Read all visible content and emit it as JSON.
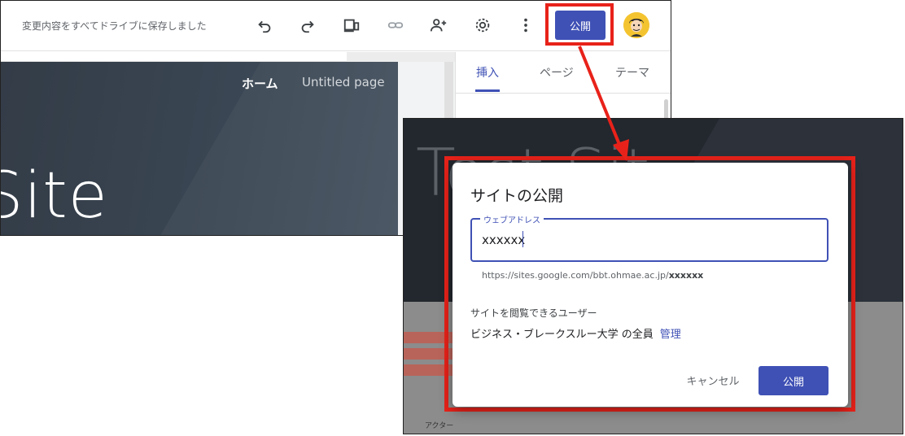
{
  "editor": {
    "save_status": "変更内容をすべてドライブに保存しました",
    "toolbar_icons": [
      "undo-icon",
      "redo-icon",
      "preview-devices-icon",
      "link-icon",
      "share-person-add-icon",
      "settings-gear-icon",
      "more-vert-icon"
    ],
    "publish_label": "公開",
    "nav": {
      "home": "ホーム",
      "untitled": "Untitled page"
    },
    "site_title_fragment": "Site",
    "side_tabs": {
      "insert": "挿入",
      "page": "ページ",
      "theme": "テーマ"
    }
  },
  "dialog": {
    "bg_title_fragment": "Test Sit",
    "bg_footer_text": "アクター",
    "title": "サイトの公開",
    "address_label": "ウェブアドレス",
    "address_value": "xxxxxx",
    "url_prefix": "https://sites.google.com/bbt.ohmae.ac.jp/",
    "url_suffix": "xxxxxx",
    "viewers_label": "サイトを閲覧できるユーザー",
    "viewers_value": "ビジネス・ブレークスルー大学 の全員",
    "manage_link": "管理",
    "cancel_label": "キャンセル",
    "publish_label": "公開"
  },
  "colors": {
    "accent": "#3f51b5",
    "highlight": "#e8221a",
    "hero_bg": "#333c47"
  }
}
